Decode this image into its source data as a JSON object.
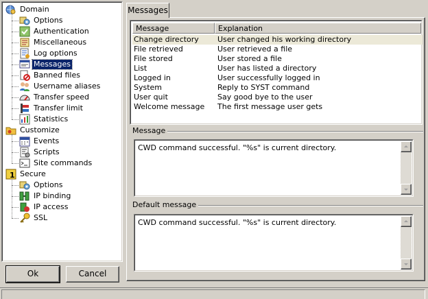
{
  "tree": {
    "nodes": [
      {
        "label": "Domain",
        "icon": "domain-icon",
        "level": 0
      },
      {
        "label": "Options",
        "icon": "options-icon",
        "level": 1
      },
      {
        "label": "Authentication",
        "icon": "authentication-icon",
        "level": 1
      },
      {
        "label": "Miscellaneous",
        "icon": "miscellaneous-icon",
        "level": 1
      },
      {
        "label": "Log options",
        "icon": "log-options-icon",
        "level": 1
      },
      {
        "label": "Messages",
        "icon": "messages-icon",
        "level": 1,
        "selected": true
      },
      {
        "label": "Banned files",
        "icon": "banned-files-icon",
        "level": 1
      },
      {
        "label": "Username aliases",
        "icon": "users-icon",
        "level": 1
      },
      {
        "label": "Transfer speed",
        "icon": "gauge-icon",
        "level": 1
      },
      {
        "label": "Transfer limit",
        "icon": "limit-icon",
        "level": 1
      },
      {
        "label": "Statistics",
        "icon": "statistics-icon",
        "level": 1
      },
      {
        "label": "Customize",
        "icon": "customize-icon",
        "level": 0
      },
      {
        "label": "Events",
        "icon": "events-icon",
        "level": 1
      },
      {
        "label": "Scripts",
        "icon": "scripts-icon",
        "level": 1
      },
      {
        "label": "Site commands",
        "icon": "site-commands-icon",
        "level": 1
      },
      {
        "label": "Secure",
        "icon": "secure-icon",
        "level": 0
      },
      {
        "label": "Options",
        "icon": "options-icon",
        "level": 1
      },
      {
        "label": "IP binding",
        "icon": "ip-binding-icon",
        "level": 1
      },
      {
        "label": "IP access",
        "icon": "ip-access-icon",
        "level": 1
      },
      {
        "label": "SSL",
        "icon": "key-icon",
        "level": 1
      }
    ]
  },
  "buttons": {
    "ok": "Ok",
    "cancel": "Cancel"
  },
  "tab": {
    "label": "Messages"
  },
  "list": {
    "columns": [
      "Message",
      "Explanation"
    ],
    "rows": [
      [
        "Change directory",
        "User changed his working directory"
      ],
      [
        "File retrieved",
        "User retrieved a file"
      ],
      [
        "File stored",
        "User stored a file"
      ],
      [
        "List",
        "User has listed a directory"
      ],
      [
        "Logged in",
        "User successfully logged in"
      ],
      [
        "System",
        "Reply to SYST command"
      ],
      [
        "User quit",
        "Say good bye to the user"
      ],
      [
        "Welcome message",
        "The first message user gets"
      ]
    ]
  },
  "message": {
    "label": "Message",
    "text": "CWD command successful. \"%s\" is current directory."
  },
  "default_message": {
    "label": "Default message",
    "text": "CWD command successful. \"%s\" is current directory."
  },
  "colors": {
    "selection": "#0a246a",
    "face": "#d4d0c8"
  }
}
